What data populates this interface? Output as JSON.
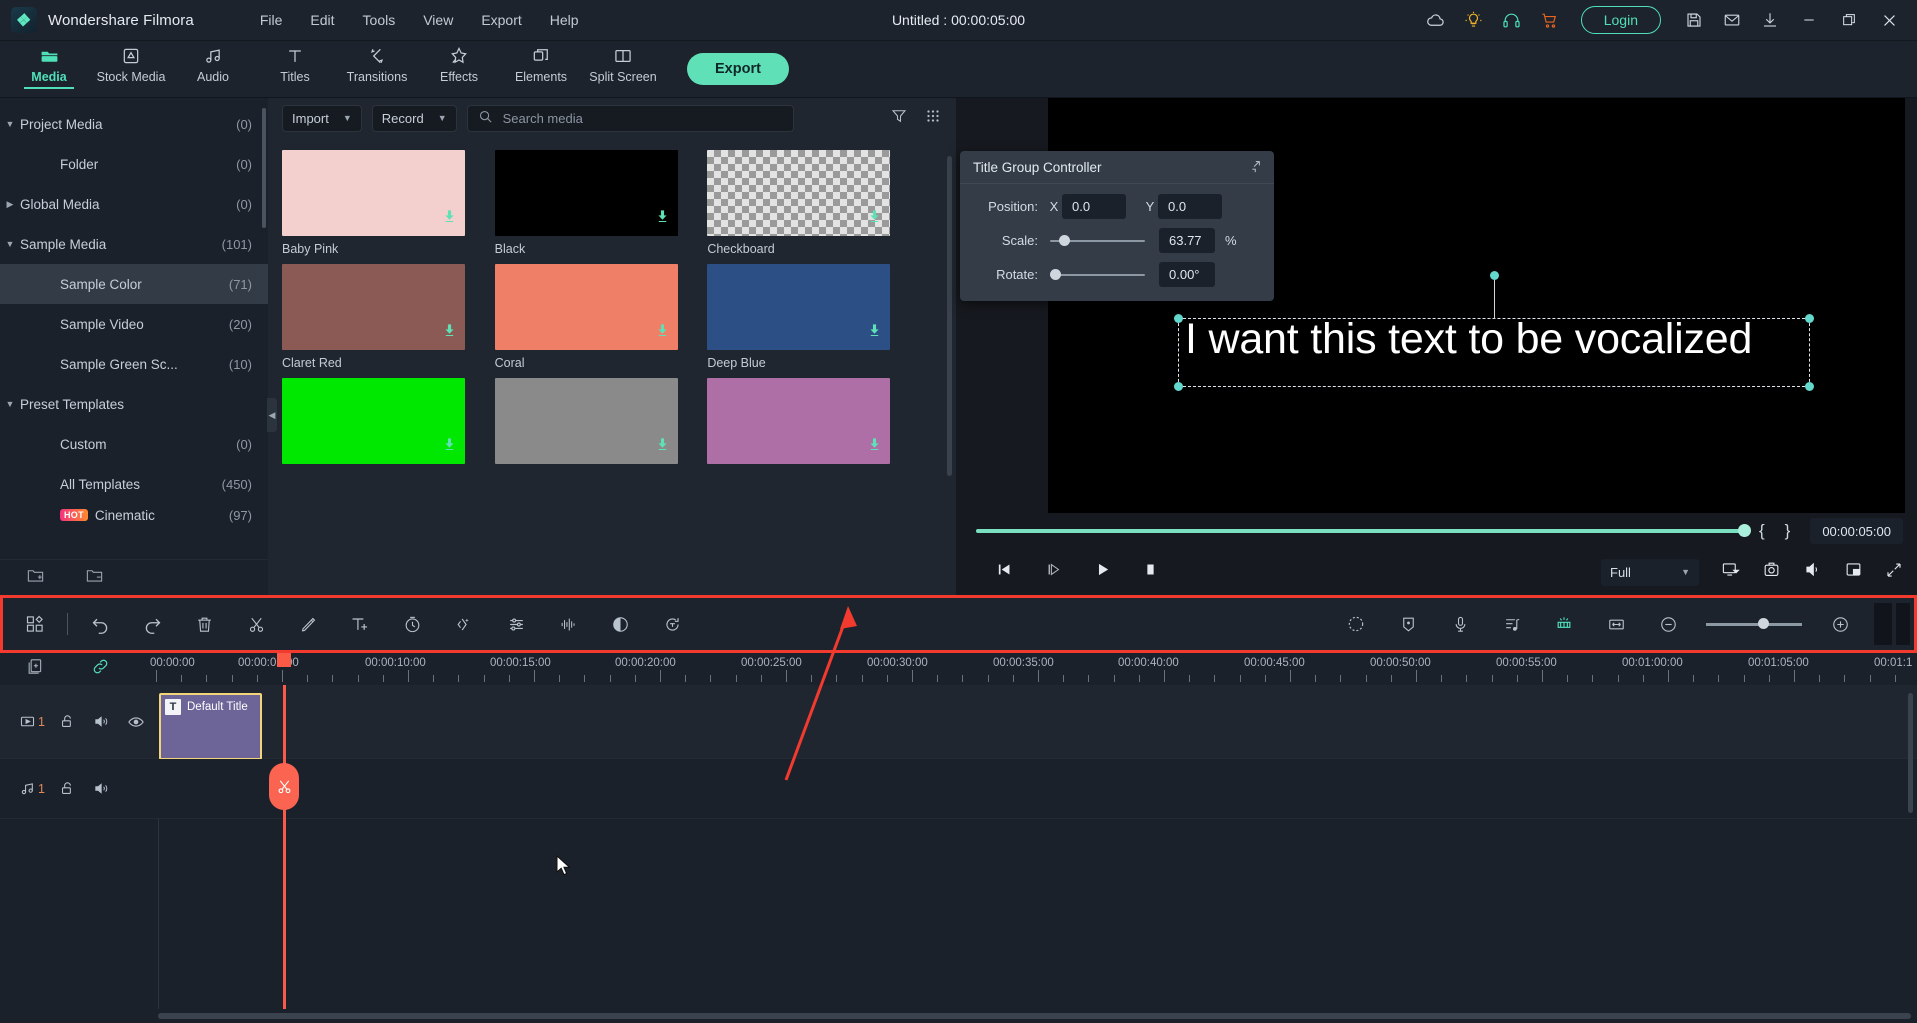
{
  "app": {
    "brand": "Wondershare Filmora",
    "document_title": "Untitled : 00:00:05:00"
  },
  "menu": [
    {
      "label": "File"
    },
    {
      "label": "Edit"
    },
    {
      "label": "Tools"
    },
    {
      "label": "View"
    },
    {
      "label": "Export"
    },
    {
      "label": "Help"
    }
  ],
  "titlebar_right": {
    "icons": [
      "cloud-icon",
      "lightbulb-icon",
      "headset-icon",
      "cart-icon"
    ],
    "login_label": "Login",
    "icons_after": [
      "save-icon",
      "mail-icon",
      "download-icon"
    ],
    "window_controls": [
      "minimize",
      "restore",
      "close"
    ]
  },
  "nav_tabs": [
    {
      "label": "Media",
      "icon": "folder-icon",
      "active": true
    },
    {
      "label": "Stock Media",
      "icon": "stock-media-icon",
      "active": false
    },
    {
      "label": "Audio",
      "icon": "music-note-icon",
      "active": false
    },
    {
      "label": "Titles",
      "icon": "text-t-icon",
      "active": false
    },
    {
      "label": "Transitions",
      "icon": "transitions-icon",
      "active": false
    },
    {
      "label": "Effects",
      "icon": "effects-star-icon",
      "active": false
    },
    {
      "label": "Elements",
      "icon": "elements-icon",
      "active": false
    },
    {
      "label": "Split Screen",
      "icon": "split-screen-icon",
      "active": false
    }
  ],
  "export_button": "Export",
  "sidebar": {
    "items": [
      {
        "label": "Project Media",
        "count": "(0)",
        "indent": 0,
        "arrow": "down",
        "selected": false
      },
      {
        "label": "Folder",
        "count": "(0)",
        "indent": 1,
        "arrow": "",
        "selected": false
      },
      {
        "label": "Global Media",
        "count": "(0)",
        "indent": 0,
        "arrow": "right",
        "selected": false
      },
      {
        "label": "Sample Media",
        "count": "(101)",
        "indent": 0,
        "arrow": "down",
        "selected": false
      },
      {
        "label": "Sample Color",
        "count": "(71)",
        "indent": 1,
        "arrow": "",
        "selected": true
      },
      {
        "label": "Sample Video",
        "count": "(20)",
        "indent": 1,
        "arrow": "",
        "selected": false
      },
      {
        "label": "Sample Green Sc...",
        "count": "(10)",
        "indent": 1,
        "arrow": "",
        "selected": false
      },
      {
        "label": "Preset Templates",
        "count": "",
        "indent": 0,
        "arrow": "down",
        "selected": false
      },
      {
        "label": "Custom",
        "count": "(0)",
        "indent": 1,
        "arrow": "",
        "selected": false
      },
      {
        "label": "All Templates",
        "count": "(450)",
        "indent": 1,
        "arrow": "",
        "selected": false
      },
      {
        "label": "Cinematic",
        "count": "(97)",
        "indent": 1,
        "arrow": "",
        "selected": false,
        "badge": "HOT"
      }
    ],
    "footer_icons": [
      "new-folder-icon",
      "remove-folder-icon"
    ]
  },
  "media_panel": {
    "import_label": "Import",
    "record_label": "Record",
    "search_placeholder": "Search media",
    "tool_icons": [
      "filter-icon",
      "grid-view-icon"
    ],
    "items": [
      {
        "name": "Baby Pink",
        "color": "#f3d0cd",
        "type": "solid"
      },
      {
        "name": "Black",
        "color": "#000000",
        "type": "solid"
      },
      {
        "name": "Checkboard",
        "color": "",
        "type": "checker"
      },
      {
        "name": "Claret Red",
        "color": "#8c5a54",
        "type": "solid"
      },
      {
        "name": "Coral",
        "color": "#f07f68",
        "type": "solid"
      },
      {
        "name": "Deep Blue",
        "color": "#2c4f85",
        "type": "solid"
      },
      {
        "name": "",
        "color": "#00e800",
        "type": "solid"
      },
      {
        "name": "",
        "color": "#8a8a8a",
        "type": "solid"
      },
      {
        "name": "",
        "color": "#ad6fa6",
        "type": "solid"
      }
    ]
  },
  "title_group_controller": {
    "title": "Title Group Controller",
    "minimize_icon": "collapse-icon",
    "position_label": "Position:",
    "x_axis": "X",
    "x_value": "0.0",
    "y_axis": "Y",
    "y_value": "0.0",
    "scale_label": "Scale:",
    "scale_value": "63.77",
    "scale_unit": "%",
    "scale_percent": 12,
    "rotate_label": "Rotate:",
    "rotate_value": "0.00°",
    "rotate_percent": 2
  },
  "preview": {
    "overlay_text": "I want this text to be vocalized",
    "timecode": "00:00:05:00",
    "brace_in": "{",
    "brace_out": "}",
    "seek_percent": 100,
    "quality_label": "Full",
    "transport_icons": [
      "prev-frame-icon",
      "next-frame-icon",
      "play-icon",
      "stop-icon"
    ],
    "right_icons": [
      "snapshot-screen-icon",
      "camera-icon",
      "volume-icon",
      "pip-icon",
      "fullscreen-icon"
    ]
  },
  "toolbar": {
    "left_icons": [
      "layout-icon",
      "undo-icon",
      "redo-icon",
      "delete-icon",
      "split-scissors-icon",
      "crop-icon",
      "add-text-icon",
      "speed-icon",
      "keyframe-icon",
      "color-adjust-icon",
      "audio-waveform-icon",
      "mask-icon",
      "auto-reframe-icon"
    ],
    "right_icons": [
      "motion-tracking-icon",
      "marker-icon",
      "voiceover-mic-icon",
      "beat-detect-icon",
      "silence-detect-icon",
      "fit-timeline-icon",
      "zoom-out-icon"
    ],
    "zoom_in_icon": "zoom-in-icon",
    "zoom_level_percent": 54
  },
  "timeline": {
    "head_icons": [
      "add-track-icon",
      "link-icon"
    ],
    "ruler_labels": [
      "00:00:00",
      "00:00:05:00",
      "00:00:10:00",
      "00:00:15:00",
      "00:00:20:00",
      "00:00:25:00",
      "00:00:30:00",
      "00:00:35:00",
      "00:00:40:00",
      "00:00:45:00",
      "00:00:50:00",
      "00:00:55:00",
      "00:01:00:00",
      "00:01:05:00",
      "00:01:1"
    ],
    "video_track": {
      "number": "1",
      "icons": [
        "video-track-icon",
        "unlock-icon",
        "mute-icon",
        "eye-icon"
      ],
      "clip": {
        "label": "Default Title",
        "icon": "title-t-icon"
      }
    },
    "audio_track": {
      "number": "1",
      "icons": [
        "audio-track-icon",
        "unlock-icon",
        "mute-icon"
      ]
    },
    "playhead_position": "00:00:05:00",
    "split_icon": "scissors-icon"
  },
  "annotation": {
    "arrow_color": "#f23a2e"
  }
}
